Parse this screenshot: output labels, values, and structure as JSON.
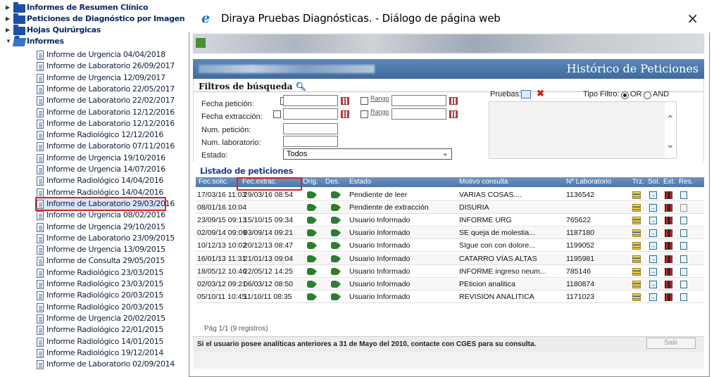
{
  "tree": {
    "groups": [
      {
        "label": "Informes de Resumen Clínico",
        "expanded": false
      },
      {
        "label": "Peticiones de Diagnóstico por Imagen",
        "expanded": false
      },
      {
        "label": "Hojas Quirúrgicas",
        "expanded": false
      },
      {
        "label": "Informes",
        "expanded": true
      }
    ],
    "items": [
      "Informe de Urgencia 04/04/2018",
      "Informe de Laboratorio 26/09/2017",
      "Informe de Urgencia 12/09/2017",
      "Informe de Laboratorio 22/05/2017",
      "Informe de Laboratorio 22/02/2017",
      "Informe de Laboratorio 12/12/2016",
      "Informe de Laboratorio 12/12/2016",
      "Informe Radiológico 12/12/2016",
      "Informe de Laboratorio 07/11/2016",
      "Informe de Urgencia 19/10/2016",
      "Informe de Urgencia 14/07/2016",
      "Informe Radiológico 14/04/2016",
      "Informe Radiológico 14/04/2016",
      "Informe de Laboratorio 29/03/2016",
      "Informe de Urgencia 08/02/2016",
      "Informe de Urgencia 29/10/2015",
      "Informe de Laboratorio 23/09/2015",
      "Informe de Urgencia 13/09/2015",
      "Informe de Consulta 29/05/2015",
      "Informe Radiológico 23/03/2015",
      "Informe Radiológico 23/03/2015",
      "Informe Radiológico 20/03/2015",
      "Informe Radiológico 20/03/2015",
      "Informe de Urgencia 20/02/2015",
      "Informe Radiológico 22/01/2015",
      "Informe Radiológico 14/01/2015",
      "Informe Radiológico 19/12/2014",
      "Informe de Laboratorio 02/09/2014"
    ],
    "selected_index": 13
  },
  "dialog": {
    "title": "Diraya Pruebas Diagnósticas. - Diálogo de página web",
    "close": "×",
    "header_title": "Histórico de Peticiones",
    "filters": {
      "tab": "Filtros de búsqueda",
      "fecha_peticion": "Fecha petición:",
      "fecha_extraccion": "Fecha extracción:",
      "num_peticion": "Num. petición:",
      "num_laboratorio": "Num. laboratorio:",
      "estado": "Estado:",
      "estado_value": "Todos",
      "rango": "Rango",
      "pruebas": "Pruebas:",
      "tipo_filtro": "Tipo Filtro:",
      "or": "OR",
      "and": "AND"
    },
    "list": {
      "title": "Listado de peticiones",
      "columns": [
        "Fec.solic.",
        "Fec.extrac.",
        "Orig.",
        "Des.",
        "Estado",
        "Motivo consulta",
        "Nº Laboratorio",
        "Trz.",
        "Sol.",
        "Ext.",
        "Res."
      ],
      "rows": [
        {
          "fec_solic": "17/03/16 11:03",
          "fec_extrac": "29/03/16 08:54",
          "estado": "Pendiente de leer",
          "motivo": "VARIAS COSAS....",
          "lab": "1136542",
          "res_gray": false
        },
        {
          "fec_solic": "08/01/16 10:04",
          "fec_extrac": "",
          "estado": "Pendiente de extracción",
          "motivo": "DISURIA",
          "lab": "",
          "res_gray": true
        },
        {
          "fec_solic": "23/09/15 09:13",
          "fec_extrac": "15/10/15 09:34",
          "estado": "Usuario Informado",
          "motivo": "INFORME URG",
          "lab": "765622",
          "res_gray": false
        },
        {
          "fec_solic": "02/09/14 09:09",
          "fec_extrac": "03/09/14 09:21",
          "estado": "Usuario Informado",
          "motivo": "SE queja de molestia...",
          "lab": "1187180",
          "res_gray": false
        },
        {
          "fec_solic": "10/12/13 10:02",
          "fec_extrac": "20/12/13 08:47",
          "estado": "Usuario Informado",
          "motivo": "SIgue con con dolore...",
          "lab": "1199052",
          "res_gray": false
        },
        {
          "fec_solic": "16/01/13 11:31",
          "fec_extrac": "21/01/13 09:04",
          "estado": "Usuario Informado",
          "motivo": "CATARRO VÍAS ALTAS",
          "lab": "1195981",
          "res_gray": false
        },
        {
          "fec_solic": "18/05/12 10:46",
          "fec_extrac": "22/05/12 14:25",
          "estado": "Usuario Informado",
          "motivo": "INFORME ingreso neum...",
          "lab": "785146",
          "res_gray": false
        },
        {
          "fec_solic": "02/03/12 09:21",
          "fec_extrac": "06/03/12 08:50",
          "estado": "Usuario Informado",
          "motivo": "PEticion analitica",
          "lab": "1180874",
          "res_gray": false
        },
        {
          "fec_solic": "05/10/11 10:45",
          "fec_extrac": "11/10/11 08:35",
          "estado": "Usuario Informado",
          "motivo": "REVISION ANALITICA",
          "lab": "1171023",
          "res_gray": false
        }
      ],
      "pagination": "Pág 1/1 (9 registros)"
    },
    "footer": {
      "message": "Si el usuario posee analíticas anteriores a 31 de Mayo del 2010, contacte con CGES para su consulta.",
      "salir": "Salir"
    }
  }
}
